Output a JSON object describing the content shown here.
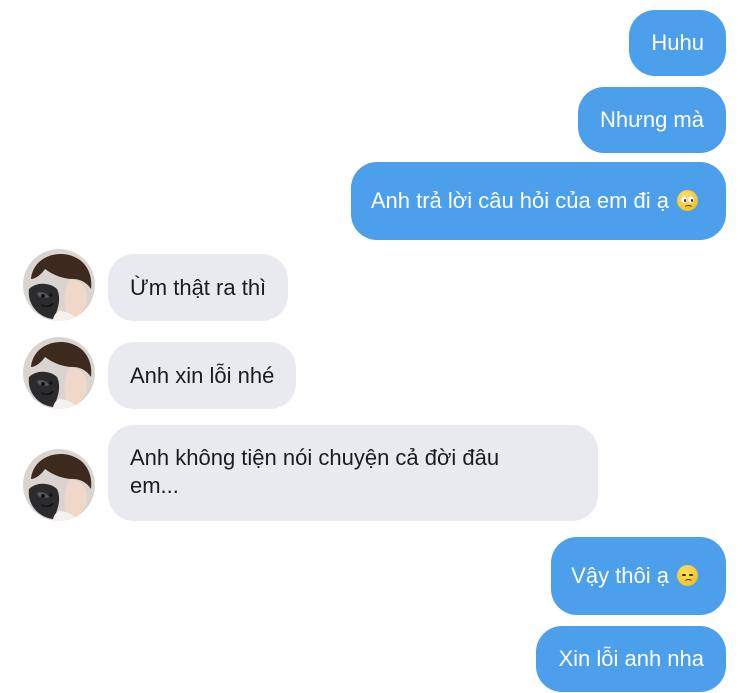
{
  "colors": {
    "outgoing_bubble": "#4c9fea",
    "incoming_bubble": "#e9eaef",
    "outgoing_text": "#ffffff",
    "incoming_text": "#1c1c1e"
  },
  "messages": [
    {
      "direction": "outgoing",
      "text": "Huhu"
    },
    {
      "direction": "outgoing",
      "text": "Nhưng mà"
    },
    {
      "direction": "outgoing",
      "text": "Anh trả lời câu hỏi của em đi ạ",
      "emoji": "pleading-face-emoji"
    },
    {
      "direction": "incoming",
      "text": "Ừm thật ra thì",
      "avatar": "contact-avatar"
    },
    {
      "direction": "incoming",
      "text": "Anh xin lỗi nhé",
      "avatar": "contact-avatar"
    },
    {
      "direction": "incoming",
      "line1": "Anh không tiện nói chuyện cả đời đâu",
      "line2": "em...",
      "avatar": "contact-avatar"
    },
    {
      "direction": "outgoing",
      "text": "Vậy thôi ạ",
      "emoji": "disappointed-face-emoji"
    },
    {
      "direction": "outgoing",
      "text": "Xin lỗi anh nha"
    }
  ]
}
